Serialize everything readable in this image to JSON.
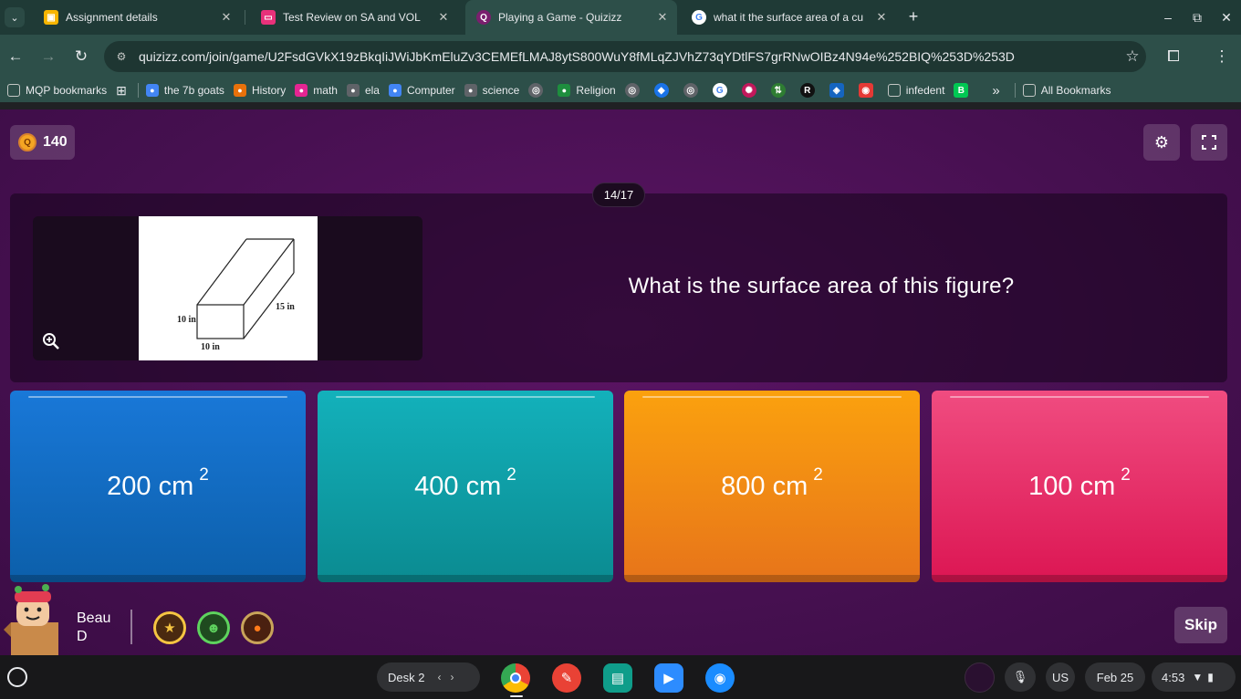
{
  "browser": {
    "tabs": [
      {
        "title": "Assignment details",
        "favicon_color": "#f7b500",
        "active": false
      },
      {
        "title": "Test Review on SA and VOL",
        "favicon_color": "#e8317a",
        "active": false
      },
      {
        "title": "Playing a Game - Quizizz",
        "favicon_color": "#7a1f6e",
        "active": true
      },
      {
        "title": "what it the surface area of a cu",
        "favicon_color": "#ffffff",
        "active": false
      }
    ],
    "tab_close_glyph": "✕",
    "new_tab_glyph": "+",
    "window_controls": [
      "–",
      "⧉",
      "✕"
    ],
    "url": "quizizz.com/join/game/U2FsdGVkX19zBkqIiJWiJbKmEluZv3CEMEfLMAJ8ytS800WuY8fMLqZJVhZ73qYDtlFS7grRNwOIBz4N94e%252BIQ%253D%253D",
    "bookmarks": [
      {
        "label": "MQP bookmarks",
        "icon": "folder-icon",
        "color": "#5f6368"
      },
      {
        "label": "the 7b goats",
        "icon": "classroom-icon",
        "color": "#4285f4"
      },
      {
        "label": "History",
        "icon": "classroom-icon",
        "color": "#e8710a"
      },
      {
        "label": "math",
        "icon": "classroom-icon",
        "color": "#e52592"
      },
      {
        "label": "ela",
        "icon": "classroom-icon",
        "color": "#5f6368"
      },
      {
        "label": "Computer",
        "icon": "classroom-icon",
        "color": "#4285f4"
      },
      {
        "label": "science",
        "icon": "classroom-icon",
        "color": "#5f6368"
      },
      {
        "label": "Religion",
        "icon": "classroom-icon",
        "color": "#1e8e3e"
      }
    ],
    "bookmarks_right": [
      "infedent",
      "All Bookmarks"
    ],
    "overflow_glyph": "»"
  },
  "quiz": {
    "score": "140",
    "counter": "14/17",
    "question": "What is the surface area of this figure?",
    "figure_labels": {
      "height": "10 in",
      "width": "10 in",
      "depth": "15 in"
    },
    "options": [
      {
        "value": "200 cm",
        "exponent": "2",
        "color": "#1978d8"
      },
      {
        "value": "400 cm",
        "exponent": "2",
        "color": "#13b1bb"
      },
      {
        "value": "800 cm",
        "exponent": "2",
        "color": "#fba10e"
      },
      {
        "value": "100 cm",
        "exponent": "2",
        "color": "#f04c80"
      }
    ],
    "player": {
      "first": "Beau",
      "last": "D"
    },
    "skip_label": "Skip"
  },
  "shelf": {
    "desk_label": "Desk 2",
    "lang": "US",
    "date": "Feb 25",
    "time": "4:53"
  }
}
